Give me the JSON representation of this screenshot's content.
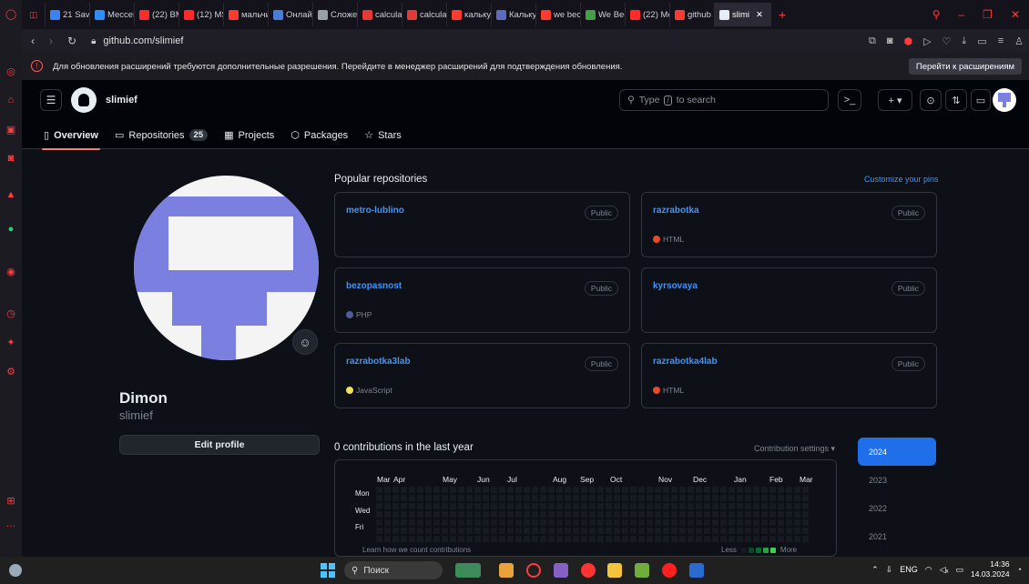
{
  "browser": {
    "tabs": [
      {
        "label": "21 Sava",
        "color": "#3b82f6"
      },
      {
        "label": "Мессен",
        "color": "#2f8df5"
      },
      {
        "label": "(22) ВМ",
        "color": "#ff2a2a"
      },
      {
        "label": "(12) МЅ",
        "color": "#ff2a2a"
      },
      {
        "label": "мальчи",
        "color": "#ff3b2f"
      },
      {
        "label": "Онлайн",
        "color": "#4c7bd6"
      },
      {
        "label": "Сложен",
        "color": "#9aa0a6"
      },
      {
        "label": "calculat",
        "color": "#e53935"
      },
      {
        "label": "calculat",
        "color": "#e53935"
      },
      {
        "label": "калькул",
        "color": "#ff3b2f"
      },
      {
        "label": "Калькул",
        "color": "#5c6bc0"
      },
      {
        "label": "we becc",
        "color": "#ff3b2f"
      },
      {
        "label": "We Bec",
        "color": "#43a047"
      },
      {
        "label": "(22) Мо",
        "color": "#ff2a2a"
      },
      {
        "label": "github",
        "color": "#ff3b2f"
      },
      {
        "label": "slimi",
        "color": "#e6edf3",
        "active": true
      }
    ],
    "url": "github.com/slimief",
    "info_text": "Для обновления расширений требуются дополнительные разрешения. Перейдите в менеджер расширений для подтверждения обновления.",
    "info_button": "Перейти к расширениям"
  },
  "header": {
    "username": "slimief",
    "search_prefix": "Type",
    "search_key": "/",
    "search_suffix": "to search"
  },
  "nav": {
    "overview": "Overview",
    "repositories": "Repositories",
    "repo_count": "25",
    "projects": "Projects",
    "packages": "Packages",
    "stars": "Stars"
  },
  "profile": {
    "name": "Dimon",
    "login": "slimief",
    "edit_button": "Edit profile"
  },
  "popular": {
    "title": "Popular repositories",
    "customize": "Customize your pins",
    "repos": [
      {
        "name": "metro-lublino",
        "visibility": "Public",
        "lang": "",
        "lang_color": ""
      },
      {
        "name": "razrabotka",
        "visibility": "Public",
        "lang": "HTML",
        "lang_color": "#e34c26"
      },
      {
        "name": "bezopasnost",
        "visibility": "Public",
        "lang": "PHP",
        "lang_color": "#4F5D95"
      },
      {
        "name": "kyrsovaya",
        "visibility": "Public",
        "lang": "",
        "lang_color": ""
      },
      {
        "name": "razrabotka3lab",
        "visibility": "Public",
        "lang": "JavaScript",
        "lang_color": "#f1e05a"
      },
      {
        "name": "razrabotka4lab",
        "visibility": "Public",
        "lang": "HTML",
        "lang_color": "#e34c26"
      }
    ]
  },
  "contributions": {
    "title": "0 contributions in the last year",
    "settings": "Contribution settings",
    "months": [
      "Mar",
      "Apr",
      "May",
      "Jun",
      "Jul",
      "Aug",
      "Sep",
      "Oct",
      "Nov",
      "Dec",
      "Jan",
      "Feb",
      "Mar"
    ],
    "days": [
      "Mon",
      "Wed",
      "Fri"
    ],
    "learn": "Learn how we count contributions",
    "less": "Less",
    "more": "More",
    "years": [
      "2024",
      "2023",
      "2022",
      "2021"
    ],
    "selected_year": "2024"
  },
  "taskbar": {
    "search": "Поиск",
    "lang": "ENG",
    "time": "14:36",
    "date": "14.03.2024"
  }
}
